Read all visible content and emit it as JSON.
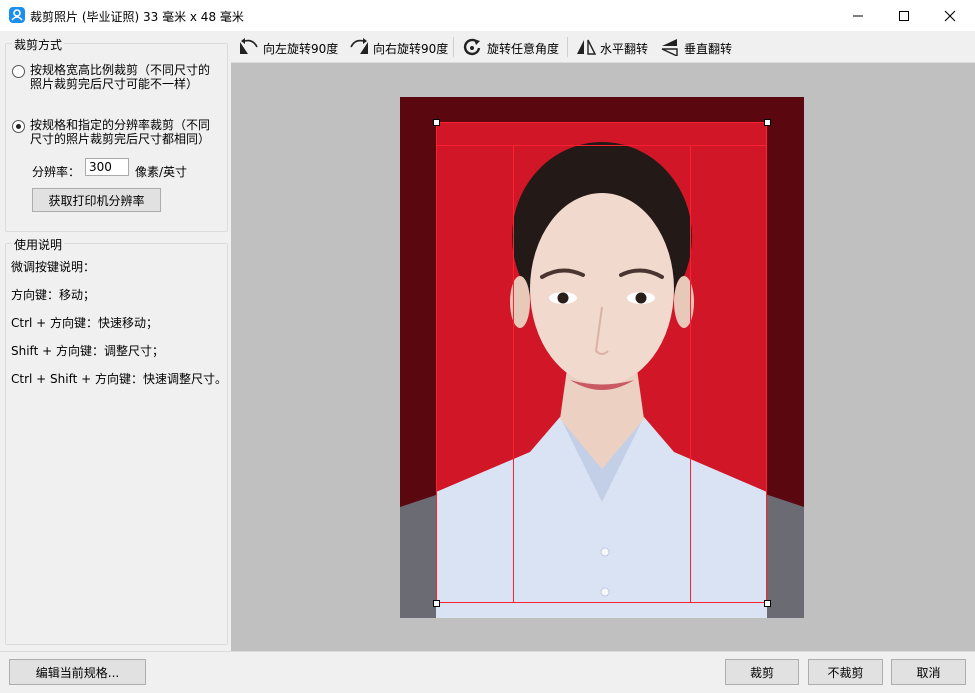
{
  "window": {
    "title": "裁剪照片 (毕业证照) 33 毫米 x 48 毫米"
  },
  "crop_mode": {
    "legend": "裁剪方式",
    "option_ratio": "按规格宽高比例裁剪（不同尺寸的照片裁剪完后尺寸可能不一样）",
    "option_resolution": "按规格和指定的分辨率裁剪（不同尺寸的照片裁剪完后尺寸都相同）",
    "selected": "option_resolution",
    "resolution_label": "分辨率：",
    "resolution_value": "300",
    "resolution_unit": "像素/英寸",
    "printer_button": "获取打印机分辨率"
  },
  "help": {
    "legend": "使用说明",
    "lines": [
      "微调按键说明：",
      "方向键：移动；",
      "Ctrl + 方向键：快速移动；",
      "Shift + 方向键：调整尺寸；",
      "Ctrl + Shift + 方向键：快速调整尺寸。"
    ]
  },
  "toolbar": {
    "rotate_left": "向左旋转90度",
    "rotate_right": "向右旋转90度",
    "rotate_any": "旋转任意角度",
    "flip_horizontal": "水平翻转",
    "flip_vertical": "垂直翻转"
  },
  "colors": {
    "photo_background": "#d11628",
    "crop_line": "#ff2030",
    "shirt": "#d9e3f4"
  },
  "buttons": {
    "edit_spec": "编辑当前规格...",
    "crop": "裁剪",
    "no_crop": "不裁剪",
    "cancel": "取消"
  }
}
